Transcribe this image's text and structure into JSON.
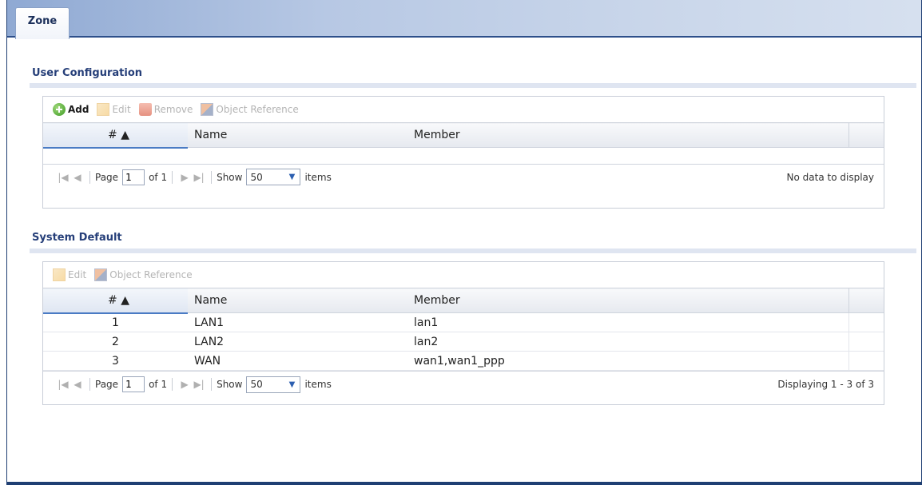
{
  "tab": {
    "label": "Zone"
  },
  "user_config": {
    "title": "User Configuration",
    "toolbar": {
      "add": "Add",
      "edit": "Edit",
      "remove": "Remove",
      "object_reference": "Object Reference"
    },
    "columns": [
      "# ▲",
      "Name",
      "Member"
    ],
    "rows": [],
    "pager": {
      "page_label": "Page",
      "page_value": "1",
      "of_label": "of 1",
      "show_label": "Show",
      "show_value": "50",
      "items_label": "items",
      "status": "No data to display"
    }
  },
  "system_default": {
    "title": "System Default",
    "toolbar": {
      "edit": "Edit",
      "object_reference": "Object Reference"
    },
    "columns": [
      "# ▲",
      "Name",
      "Member"
    ],
    "rows": [
      {
        "num": "1",
        "name": "LAN1",
        "member": "lan1"
      },
      {
        "num": "2",
        "name": "LAN2",
        "member": "lan2"
      },
      {
        "num": "3",
        "name": "WAN",
        "member": "wan1,wan1_ppp"
      }
    ],
    "pager": {
      "page_label": "Page",
      "page_value": "1",
      "of_label": "of 1",
      "show_label": "Show",
      "show_value": "50",
      "items_label": "items",
      "status": "Displaying 1 - 3 of 3"
    }
  }
}
